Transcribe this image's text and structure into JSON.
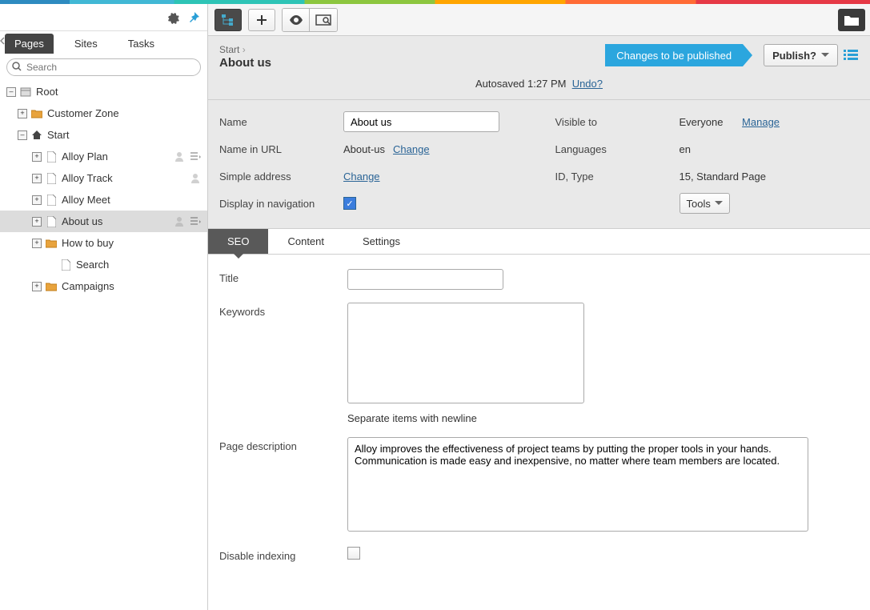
{
  "nav": {
    "tabs": {
      "pages": "Pages",
      "sites": "Sites",
      "tasks": "Tasks"
    },
    "search_placeholder": "Search"
  },
  "tree": {
    "root": "Root",
    "customer_zone": "Customer Zone",
    "start": "Start",
    "alloy_plan": "Alloy Plan",
    "alloy_track": "Alloy Track",
    "alloy_meet": "Alloy Meet",
    "about_us": "About us",
    "how_to_buy": "How to buy",
    "search": "Search",
    "campaigns": "Campaigns"
  },
  "header": {
    "breadcrumb_start": "Start",
    "title": "About us",
    "status": "Changes to be published",
    "publish": "Publish?",
    "autosave_prefix": "Autosaved ",
    "autosave_time": "1:27 PM",
    "undo": "Undo?"
  },
  "props": {
    "name_label": "Name",
    "name_value": "About us",
    "name_url_label": "Name in URL",
    "name_url_value": "About-us",
    "change": "Change",
    "simple_addr_label": "Simple address",
    "display_nav_label": "Display in navigation",
    "visible_to_label": "Visible to",
    "visible_to_value": "Everyone",
    "manage": "Manage",
    "languages_label": "Languages",
    "languages_value": "en",
    "idtype_label": "ID, Type",
    "idtype_value": "15, Standard Page",
    "tools": "Tools"
  },
  "tabs": {
    "seo": "SEO",
    "content": "Content",
    "settings": "Settings"
  },
  "form": {
    "title_label": "Title",
    "keywords_label": "Keywords",
    "keywords_hint": "Separate items with newline",
    "pagedesc_label": "Page description",
    "pagedesc_value": "Alloy improves the effectiveness of project teams by putting the proper tools in your hands. Communication is made easy and inexpensive, no matter where team members are located.",
    "disable_index_label": "Disable indexing"
  }
}
